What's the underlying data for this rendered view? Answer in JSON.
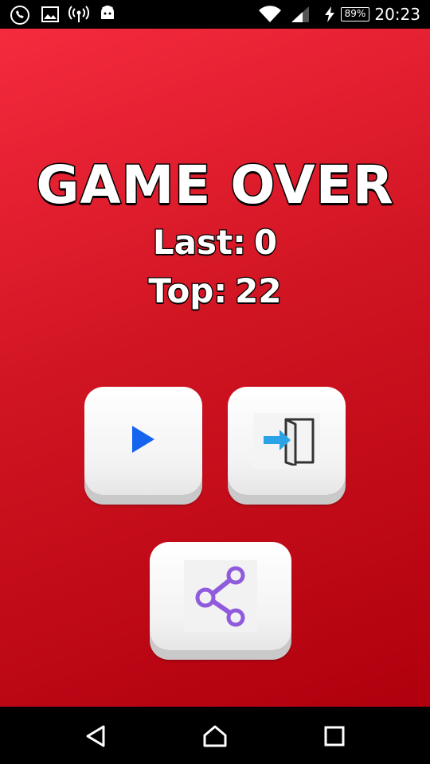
{
  "status_bar": {
    "battery_text": "89%",
    "time": "20:23",
    "icons": [
      "whatsapp-icon",
      "image-icon",
      "hotspot-icon",
      "android-icon",
      "wifi-icon",
      "signal-icon",
      "charging-icon",
      "battery-icon"
    ]
  },
  "game_over": {
    "title": "GAME OVER",
    "last_label": "Last:",
    "last_value": "0",
    "top_label": "Top:",
    "top_value": "22"
  },
  "buttons": {
    "play_icon": "play-icon",
    "exit_icon": "exit-icon",
    "share_icon": "share-icon"
  },
  "nav_bar": {
    "icons": [
      "back-icon",
      "home-icon",
      "recents-icon"
    ]
  },
  "colors": {
    "background_top": "#f52a3e",
    "background_bottom": "#b0000d",
    "play": "#1464f0",
    "exit_arrow": "#2aa3e6",
    "share": "#8f5bdc"
  }
}
